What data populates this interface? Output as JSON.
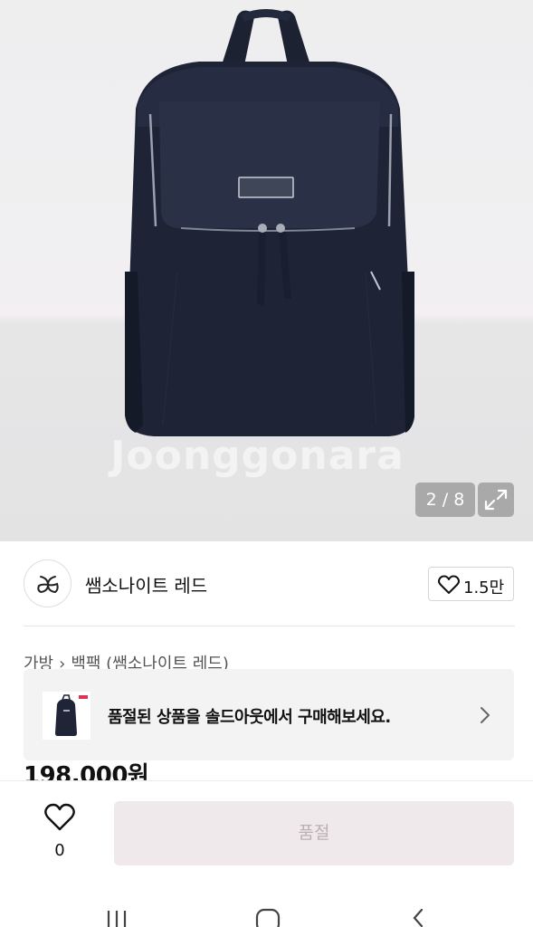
{
  "gallery": {
    "watermark": "Joonggonara",
    "counter": "2 / 8",
    "expand_icon": "expand-icon"
  },
  "store": {
    "name": "쌤소나이트 레드",
    "logo_icon": "store-logo-icon",
    "likes": "1.5만"
  },
  "breadcrumb": {
    "category": "가방",
    "subcategory": "백팩 (쌤소나이트 레드)"
  },
  "banner": {
    "text": "품절된 상품을 솔드아웃에서 구매해보세요."
  },
  "price": "198,000원",
  "bottom_bar": {
    "wish_count": "0",
    "soldout_label": "품절"
  },
  "colors": {
    "soldout_bg": "#efe9ec",
    "soldout_text": "#b9b1b5",
    "banner_bg": "#f3f3f3"
  }
}
